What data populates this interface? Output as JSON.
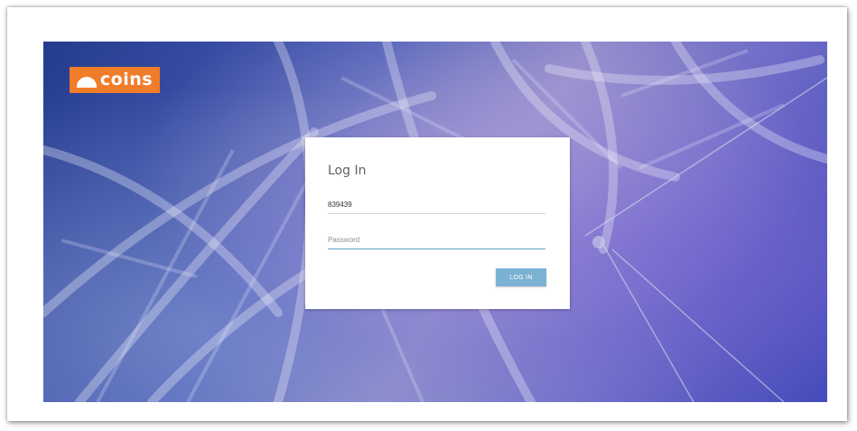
{
  "brand": {
    "name": "coins",
    "color": "#f07d2a"
  },
  "login": {
    "title": "Log In",
    "username_value": "839439",
    "password_placeholder": "Password",
    "button_label": "LOG IN",
    "button_color": "#7bb2d3"
  }
}
